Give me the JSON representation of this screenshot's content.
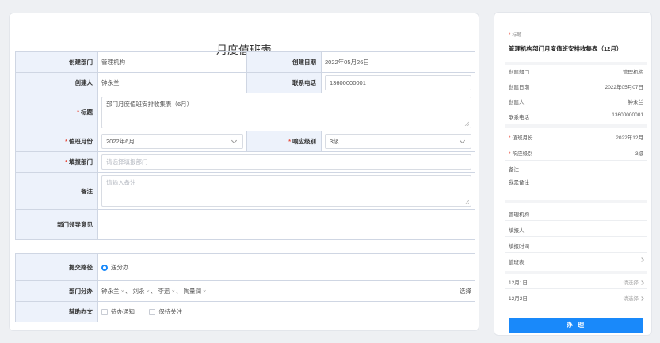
{
  "form": {
    "title": "月度值班表",
    "created_dept_label": "创建部门",
    "created_dept_value": "管理机构",
    "created_date_label": "创建日期",
    "created_date_value": "2022年05月26日",
    "creator_label": "创建人",
    "creator_value": "钟永兰",
    "phone_label": "联系电话",
    "phone_value": "13600000001",
    "title_label": "标题",
    "title_value": "部门月度值班安排收集表（6月）",
    "duty_month_label": "值班月份",
    "duty_month_value": "2022年6月",
    "response_level_label": "响应级别",
    "response_level_value": "3级",
    "report_dept_label": "填报部门",
    "report_dept_placeholder": "请选择填报部门",
    "remark_label": "备注",
    "remark_placeholder": "请输入备注",
    "leader_opinion_label": "部门领导意见"
  },
  "routing": {
    "submit_path_label": "提交路径",
    "submit_path_option": "送分办",
    "dept_assign_label": "部门分办",
    "assignees": [
      "钟永兰",
      "刘永",
      "李迅",
      "陶量润"
    ],
    "separator": "、",
    "choose_label": "选择",
    "assist_label": "辅助办文",
    "assist_options": [
      "待办通知",
      "保持关注"
    ]
  },
  "mobile": {
    "title_label": "标题",
    "title_value": "管理机构部门月度值班安排收集表（12月）",
    "rows": [
      {
        "label": "创建部门",
        "value": "管理机构"
      },
      {
        "label": "创建日期",
        "value": "2022年05月07日"
      },
      {
        "label": "创建人",
        "value": "钟永兰"
      },
      {
        "label": "联系电话",
        "value": "13600000001"
      }
    ],
    "duty_month_label": "值班月份",
    "duty_month_value": "2022年12月",
    "response_level_label": "响应级别",
    "response_level_value": "3级",
    "remark_label": "备注",
    "remark_value": "我是备注",
    "org_label": "管理机构",
    "reporter_label": "填报人",
    "report_time_label": "填报时间",
    "duty_table_label": "值班表",
    "day1_label": "12月1日",
    "day1_value": "请选择",
    "day2_label": "12月2日",
    "day2_value": "请选择",
    "submit_button": "办 理"
  },
  "icons": {
    "select": "chevron-down-icon",
    "more": "more-dots-icon",
    "remove": "close-icon",
    "nav": "chevron-right-icon"
  },
  "colors": {
    "accent": "#1989fa",
    "required": "#e74c3c",
    "label_bg": "#edf2fb"
  }
}
